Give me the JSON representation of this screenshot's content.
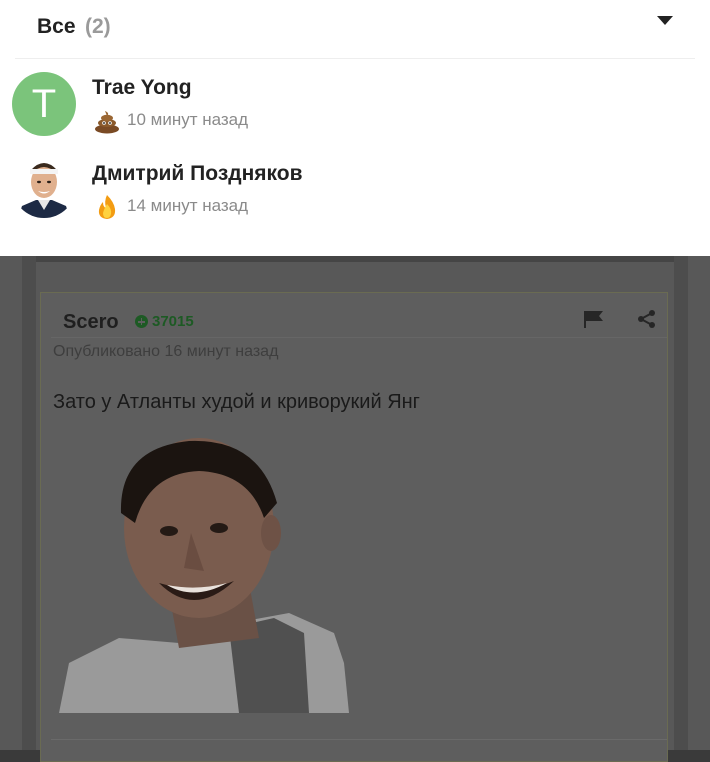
{
  "popup": {
    "tab_label": "Все",
    "tab_count": "(2)",
    "users": [
      {
        "name": "Trae Yong",
        "avatar_letter": "T",
        "reaction": "poop",
        "time": "10 минут назад"
      },
      {
        "name": "Дмитрий Поздняков",
        "reaction": "fire",
        "time": "14 минут назад"
      }
    ]
  },
  "comment": {
    "author": "Scero",
    "rating": "37015",
    "published": "Опубликовано 16 минут назад",
    "text": "Зато у Атланты худой и криворукий Янг"
  },
  "colors": {
    "avatar_green": "#7bc47b",
    "rating_green": "#1d5a24",
    "overlay": "#585858"
  }
}
